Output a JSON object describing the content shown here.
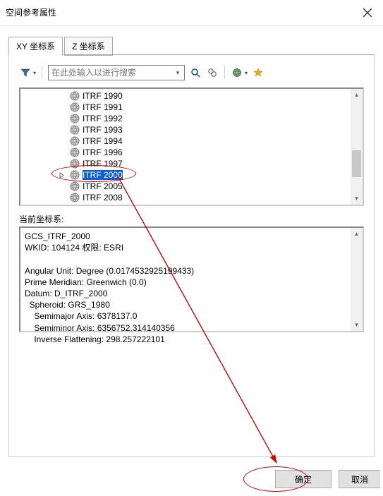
{
  "window": {
    "title": "空间参考属性"
  },
  "tabs": [
    {
      "id": "xy",
      "label": "XY 坐标系",
      "active": true
    },
    {
      "id": "z",
      "label": "Z 坐标系",
      "active": false
    }
  ],
  "search": {
    "placeholder": "在此处输入以进行搜索",
    "value": ""
  },
  "tree": {
    "items": [
      {
        "label": "ITRF 1990"
      },
      {
        "label": "ITRF 1991"
      },
      {
        "label": "ITRF 1992"
      },
      {
        "label": "ITRF 1993"
      },
      {
        "label": "ITRF 1994"
      },
      {
        "label": "ITRF 1996"
      },
      {
        "label": "ITRF 1997"
      },
      {
        "label": "ITRF 2000",
        "selected": true
      },
      {
        "label": "ITRF 2005"
      },
      {
        "label": "ITRF 2008"
      }
    ]
  },
  "current_label": "当前坐标系:",
  "current": {
    "line1": "GCS_ITRF_2000",
    "line2": "WKID: 104124 权限: ESRI",
    "line3": "",
    "line4": "Angular Unit: Degree (0.0174532925199433)",
    "line5": "Prime Meridian: Greenwich (0.0)",
    "line6": "Datum: D_ITRF_2000",
    "line7": "  Spheroid: GRS_1980",
    "line8": "    Semimajor Axis: 6378137.0",
    "line9": "    Semiminor Axis: 6356752.314140356",
    "line10": "    Inverse Flattening: 298.257222101"
  },
  "buttons": {
    "ok": "确定",
    "cancel": "取消"
  },
  "icons": {
    "filter": "filter-icon",
    "search": "search-icon",
    "find_all": "find-all-icon",
    "globe": "globe-icon",
    "star": "star-icon"
  }
}
